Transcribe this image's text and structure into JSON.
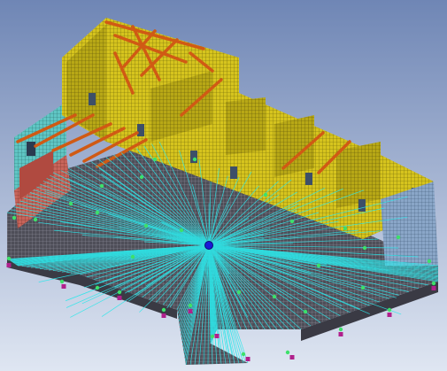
{
  "viewport": {
    "background_top": "#6f86b5",
    "background_bottom": "#dfe6f2"
  },
  "model": {
    "wall_color": "#d6c41e",
    "wall_shadow": "#a99a10",
    "end_wall_color": "#5fc6c4",
    "roof_beam_color": "#d05a14",
    "floor_color": "#4a4a52",
    "brick_color": "#c8645a",
    "spoke_color": "#2de7ea",
    "node_color": "#3de06a",
    "support_color": "#b0208c",
    "center_node_color": "#1a1ad6"
  }
}
